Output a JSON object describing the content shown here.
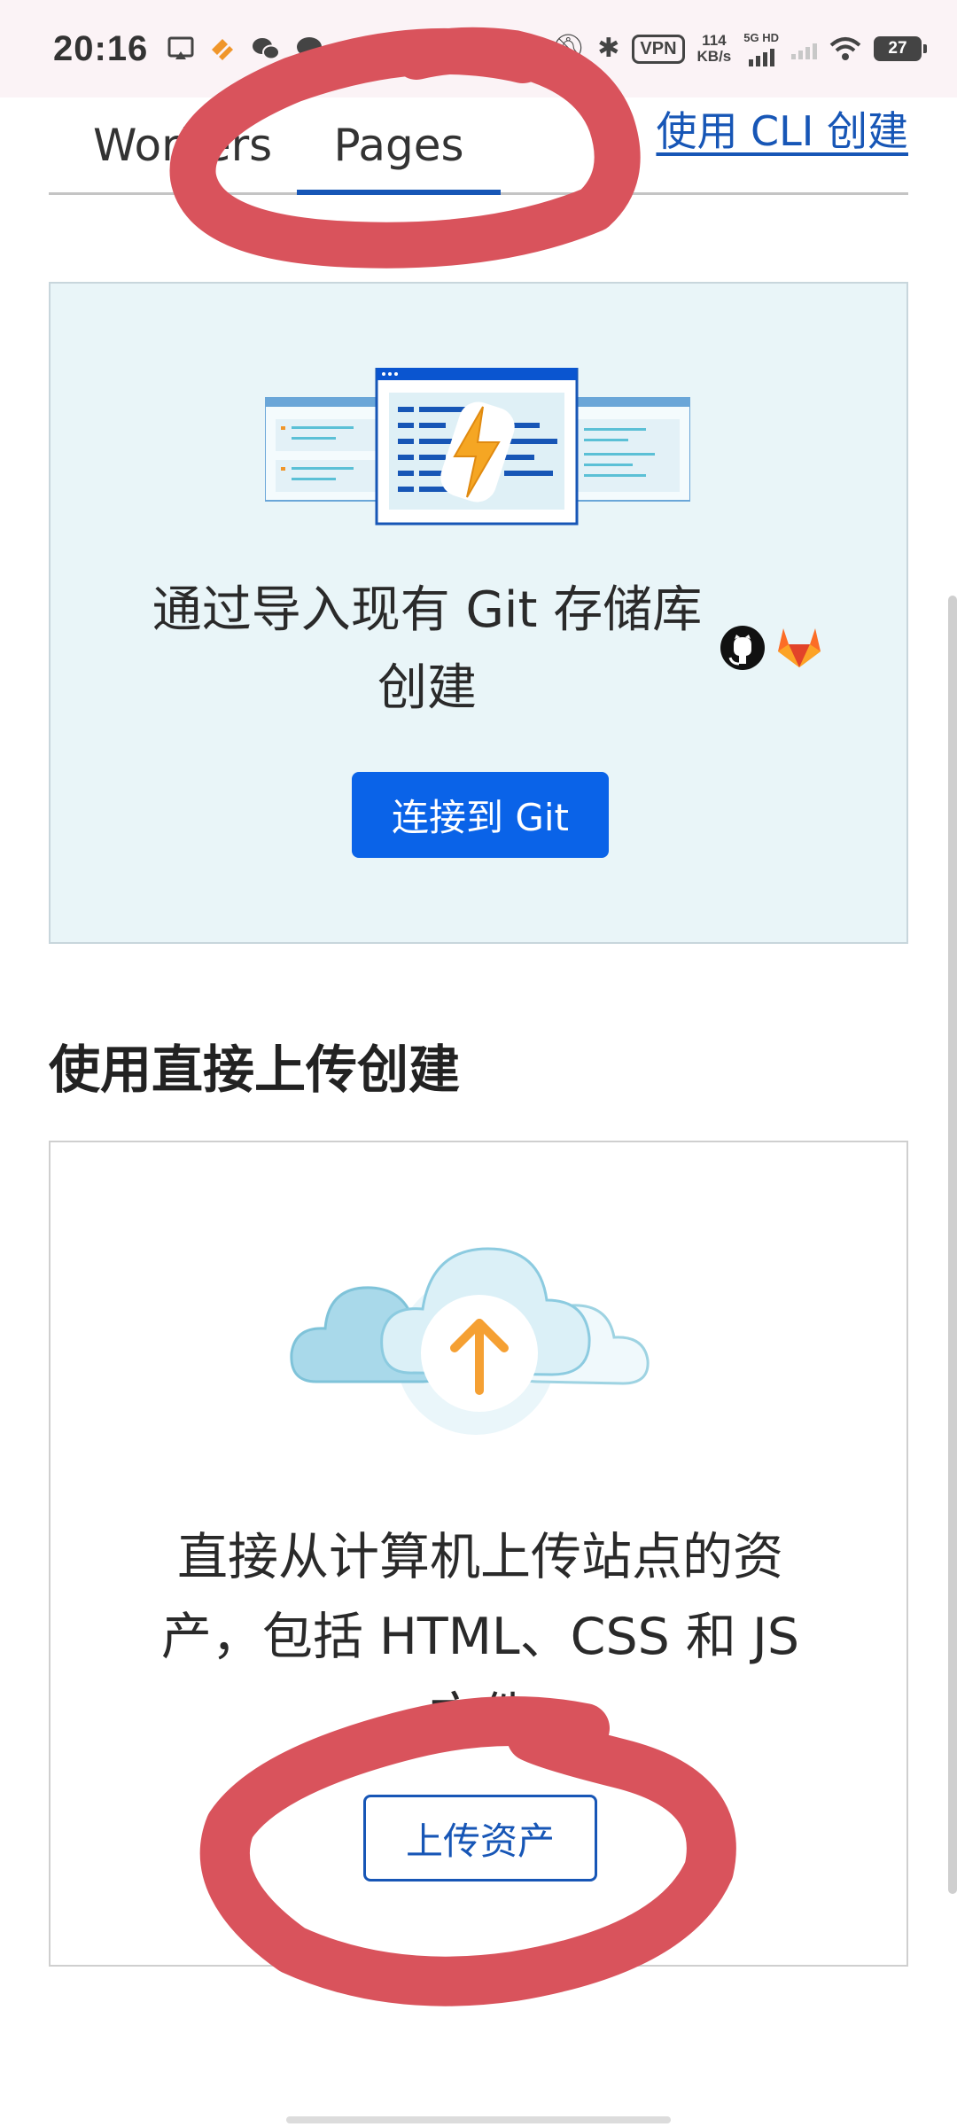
{
  "status_bar": {
    "time": "20:16",
    "left_icons": [
      "cast-icon",
      "orange-app-icon",
      "wechat-icon",
      "message-icon"
    ],
    "vpn": "VPN",
    "net_speed_value": "114",
    "net_speed_unit": "KB/s",
    "signal_label": "5G HD",
    "battery": "27"
  },
  "tabs": {
    "workers": "Workers",
    "pages": "Pages",
    "cli_link": "使用 CLI 创建"
  },
  "git_card": {
    "text_line1": "通过导入现有 Git 存储库",
    "text_line2": "创建",
    "connect_button": "连接到 Git",
    "providers": [
      "github-icon",
      "gitlab-icon"
    ]
  },
  "direct_upload": {
    "section_title": "使用直接上传创建",
    "text_line1": "直接从计算机上传站点的资",
    "text_line2": "产，包括 HTML、CSS 和 JS",
    "text_line3": "文件",
    "upload_button": "上传资产"
  },
  "colors": {
    "accent": "#1756b6",
    "primary_button": "#0a63e8",
    "git_card_bg": "#e9f5f8",
    "annotation": "#d9535c"
  }
}
